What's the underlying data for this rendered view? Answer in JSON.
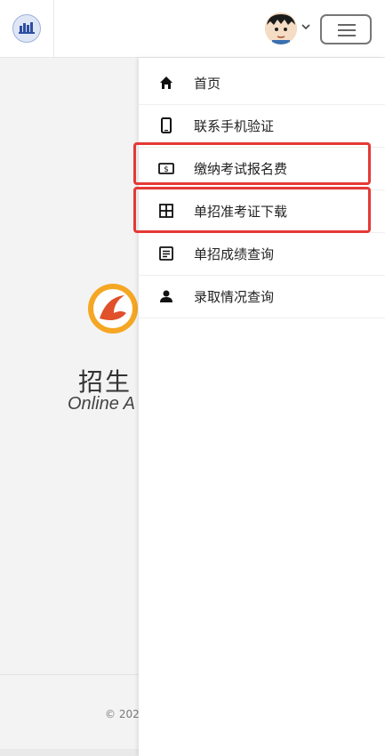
{
  "header": {
    "logo_icon": "site-logo-icon",
    "avatar_icon": "user-avatar",
    "caret_icon": "chevron-down-icon",
    "menu_icon": "hamburger-menu-icon"
  },
  "page": {
    "title": "招生",
    "subtitle": "Online A",
    "copyright": "© 202",
    "school_logo": "school-emblem"
  },
  "drawer": {
    "items": [
      {
        "label": "首页",
        "icon": "home-icon"
      },
      {
        "label": "联系手机验证",
        "icon": "phone-icon"
      },
      {
        "label": "缴纳考试报名费",
        "icon": "payment-icon",
        "highlighted": true
      },
      {
        "label": "单招准考证下载",
        "icon": "grid-icon",
        "highlighted": true
      },
      {
        "label": "单招成绩查询",
        "icon": "document-icon"
      },
      {
        "label": "录取情况查询",
        "icon": "person-icon"
      }
    ]
  },
  "colors": {
    "highlight": "#e53935",
    "drawer_bg": "#ffffff",
    "page_bg": "#f3f3f3"
  }
}
